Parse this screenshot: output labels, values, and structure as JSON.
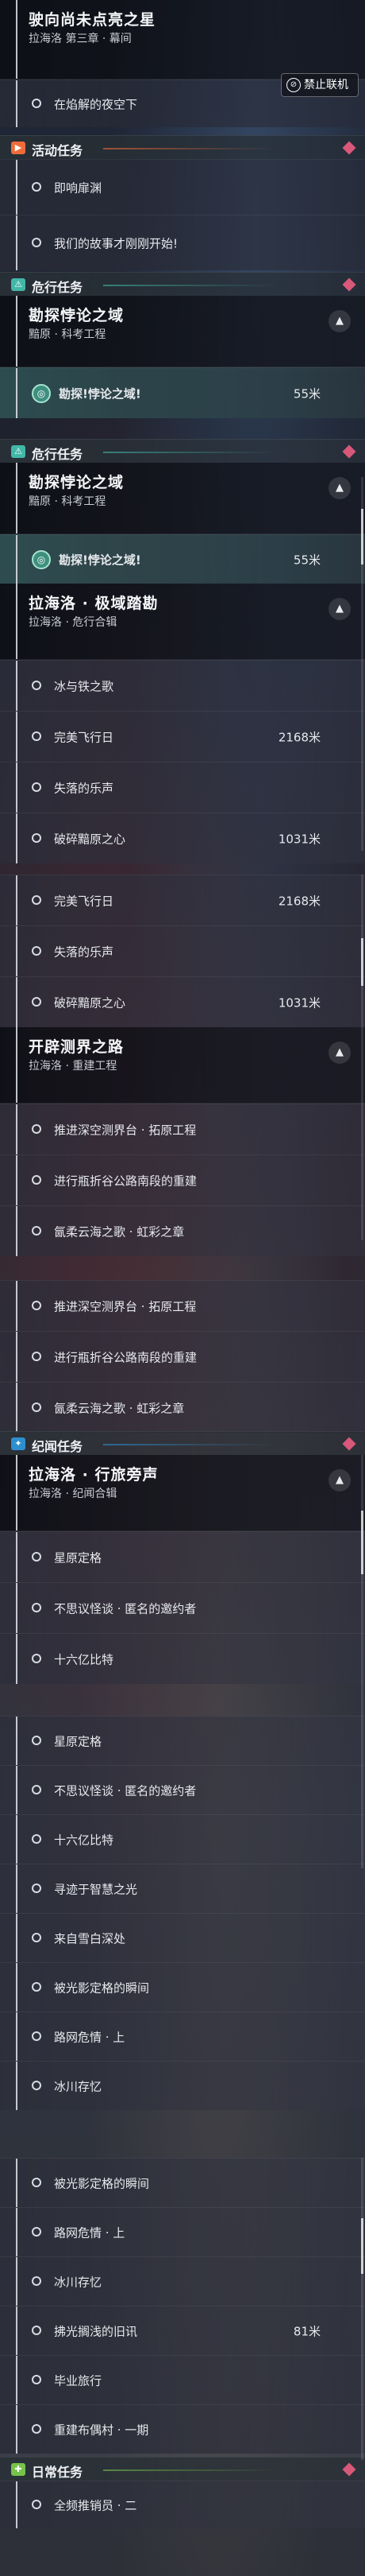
{
  "colors": {
    "activity": "#ef6c3a",
    "danger": "#42b7a8",
    "lore": "#2d8fd0",
    "daily": "#77c24b",
    "active_step": "#3e8f80"
  },
  "banned_button": {
    "icon": "ban-icon",
    "label": "禁止联机"
  },
  "top": {
    "title": "驶向尚未点亮之星",
    "sub": "拉海洛 第三章 · 幕间",
    "step": "在焰解的夜空下"
  },
  "cat1": {
    "label": "活动任务",
    "steps": [
      "即响扉渊",
      "我们的故事才刚刚开始!"
    ]
  },
  "cat2": {
    "label": "危行任务",
    "quest": {
      "title": "勘探悖论之域",
      "sub": "黯原 · 科考工程"
    },
    "active": {
      "label": "勘探!悖论之域!",
      "dist": "55米"
    }
  },
  "cat3": {
    "label": "危行任务",
    "quest1": {
      "title": "勘探悖论之域",
      "sub": "黯原 · 科考工程"
    },
    "active": {
      "label": "勘探!悖论之域!",
      "dist": "55米"
    },
    "quest2": {
      "title": "拉海洛 · 极域踏勘",
      "sub": "拉海洛 · 危行合辑"
    },
    "steps_a": [
      {
        "label": "冰与铁之歌",
        "dist": ""
      },
      {
        "label": "完美飞行日",
        "dist": "2168米"
      },
      {
        "label": "失落的乐声",
        "dist": ""
      },
      {
        "label": "破碎黯原之心",
        "dist": "1031米"
      }
    ],
    "steps_b": [
      {
        "label": "完美飞行日",
        "dist": "2168米"
      },
      {
        "label": "失落的乐声",
        "dist": ""
      },
      {
        "label": "破碎黯原之心",
        "dist": "1031米"
      }
    ],
    "quest3": {
      "title": "开辟测界之路",
      "sub": "拉海洛 · 重建工程"
    },
    "steps_c": [
      "推进深空测界台 · 拓原工程",
      "进行瓶折谷公路南段的重建",
      "氤柔云海之歌 · 虹彩之章"
    ],
    "steps_d": [
      "推进深空测界台 · 拓原工程",
      "进行瓶折谷公路南段的重建",
      "氤柔云海之歌 · 虹彩之章"
    ]
  },
  "cat4": {
    "label": "纪闻任务",
    "quest": {
      "title": "拉海洛 · 行旅旁声",
      "sub": "拉海洛 · 纪闻合辑"
    },
    "steps_a": [
      "星原定格",
      "不思议怪谈 · 匿名的邀约者",
      "十六亿比特"
    ],
    "steps_b": [
      {
        "label": "星原定格",
        "dist": ""
      },
      {
        "label": "不思议怪谈 · 匿名的邀约者",
        "dist": ""
      },
      {
        "label": "十六亿比特",
        "dist": ""
      },
      {
        "label": "寻迹于智慧之光",
        "dist": ""
      },
      {
        "label": "来自雪白深处",
        "dist": ""
      },
      {
        "label": "被光影定格的瞬间",
        "dist": ""
      },
      {
        "label": "路网危情 · 上",
        "dist": ""
      },
      {
        "label": "冰川存忆",
        "dist": ""
      }
    ],
    "steps_c": [
      {
        "label": "被光影定格的瞬间",
        "dist": ""
      },
      {
        "label": "路网危情 · 上",
        "dist": ""
      },
      {
        "label": "冰川存忆",
        "dist": ""
      },
      {
        "label": "拂光搁浅的旧讯",
        "dist": "81米"
      },
      {
        "label": "毕业旅行",
        "dist": ""
      },
      {
        "label": "重建布偶村 · 一期",
        "dist": ""
      }
    ]
  },
  "cat5": {
    "label": "日常任务",
    "steps": [
      "全频推销员 · 二"
    ]
  }
}
